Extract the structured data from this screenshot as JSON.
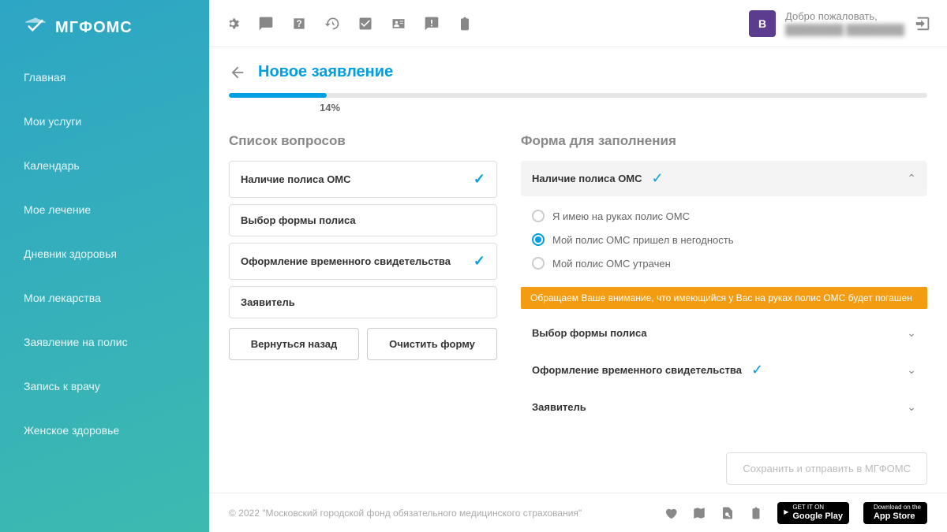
{
  "brand": "МГФОМС",
  "sidebar": {
    "items": [
      {
        "label": "Главная"
      },
      {
        "label": "Мои услуги"
      },
      {
        "label": "Календарь"
      },
      {
        "label": "Мое лечение"
      },
      {
        "label": "Дневник здоровья"
      },
      {
        "label": "Мои лекарства"
      },
      {
        "label": "Заявление на полис"
      },
      {
        "label": "Запись к врачу"
      },
      {
        "label": "Женское здоровье"
      }
    ]
  },
  "topbar": {
    "welcome": "Добро пожаловать,",
    "username_masked": "████████ ████████",
    "avatar_letter": "В"
  },
  "page": {
    "title": "Новое заявление",
    "progress_percent": 14,
    "progress_label": "14%"
  },
  "questions": {
    "title": "Список вопросов",
    "items": [
      {
        "label": "Наличие полиса ОМС",
        "done": true
      },
      {
        "label": "Выбор формы полиса",
        "done": false
      },
      {
        "label": "Оформление временного свидетельства",
        "done": true
      },
      {
        "label": "Заявитель",
        "done": false
      }
    ],
    "back_btn": "Вернуться назад",
    "clear_btn": "Очистить форму"
  },
  "form": {
    "title": "Форма для заполнения",
    "sections": [
      {
        "label": "Наличие полиса ОМС",
        "done": true,
        "expanded": true
      },
      {
        "label": "Выбор формы полиса",
        "done": false,
        "expanded": false
      },
      {
        "label": "Оформление временного свидетельства",
        "done": true,
        "expanded": false
      },
      {
        "label": "Заявитель",
        "done": false,
        "expanded": false
      }
    ],
    "radios": [
      {
        "label": "Я имею на руках полис ОМС",
        "selected": false
      },
      {
        "label": "Мой полис ОМС пришел в негодность",
        "selected": true
      },
      {
        "label": "Мой полис ОМС утрачен",
        "selected": false
      }
    ],
    "notice": "Обращаем Ваше внимание, что имеющийся у Вас на руках полис ОМС будет погашен",
    "submit": "Сохранить и отправить в МГФОМС"
  },
  "footer": {
    "copyright": "© 2022 \"Московский городской фонд обязательного медицинского страхования\"",
    "google_small": "GET IT ON",
    "google_big": "Google Play",
    "apple_small": "Download on the",
    "apple_big": "App Store"
  }
}
